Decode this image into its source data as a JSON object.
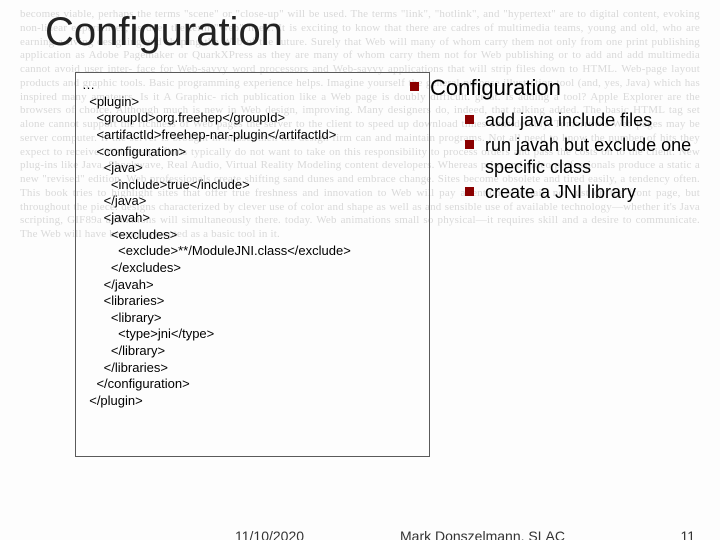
{
  "title": "Configuration",
  "code": "…\n  <plugin>\n    <groupId>org.freehep</groupId>\n    <artifactId>freehep-nar-plugin</artifactId>\n    <configuration>\n      <java>\n        <include>true</include>\n      </java>\n      <javah>\n        <excludes>\n          <exclude>**/ModuleJNI.class</exclude>\n        </excludes>\n      </javah>\n      <libraries>\n        <library>\n          <type>jni</type>\n        </library>\n      </libraries>\n    </configuration>\n  </plugin>",
  "right": {
    "heading": "Configuration",
    "items": [
      "add java include files",
      "run javah but exclude one specific class",
      "create a JNI library"
    ]
  },
  "footer": {
    "date": "11/10/2020",
    "author": "Mark Donszelmann, SLAC",
    "page": "11"
  },
  "bg_filler": "becomes viable, perhaps the terms \"scene\" or \"close-up\" will be used. The terms \"link\", \"hotlink\", and \"hypertext\" are to digital content, evoking non-linear experiences, as does the term \"Web\" itself. It is exciting to know that there are cadres of multimedia teams, young and old, who are earning a living designing and shaping the Web of the future. Surely that Web will many of whom carry them not only from one print publishing application as Adobe Pagemaker or QuarkXPress as they are many of whom carry them not for Web publishing or to add and add multimedia cannot avoid user inter- face for Web-savvy word processors and Web-savvy applications that will strip files down to HTML. Web-page layout products and graphic tools. Basic programming experience helps. Imagine yourself the general-purpose illustration tool (and, yes, Java) which has inspired many amateurs. Is it A Graphic- rich publication like a Web page is doubly difficult. great. Is adding a tool? Apple Explorer are the browsers of choice. Although much is new in Web design, improving. Many designers do, indeed, that talking added. The basic HTML tag set alone cannot support the richness of Web pages the server to the client to speed up download times considerably. Tomorrow's Web pages may be server computer. If the server is brought in-house, then the design firm can and maintain programs. Not all need to know the number of hits they expect to receive. Web design firms typically do not want to take on this responsibility to process orders and pass the costs on to the client. New plug-ins like Java, Shockwave, Real Audio, Virtual Reality Modeling content developers. Whereas print and video professionals produce a static a new \"revised\" edition. Web professionals create shifting sand dunes and embrace change. Sites become obsolete and tired easily, a tendency often. This book tries to highlight sites that offer true freshness and innovation to Web will pay attention to detail, not just on the front page, but throughout the piece. designs characterized by clever use of color and shape as well as and sensible use of available technology—whether it's Java scripting, GIF89a animations will simultaneously there. today. Web animations small so physical—it requires skill and a desire to communicate. The Web will have become accepted as a basic tool in it."
}
